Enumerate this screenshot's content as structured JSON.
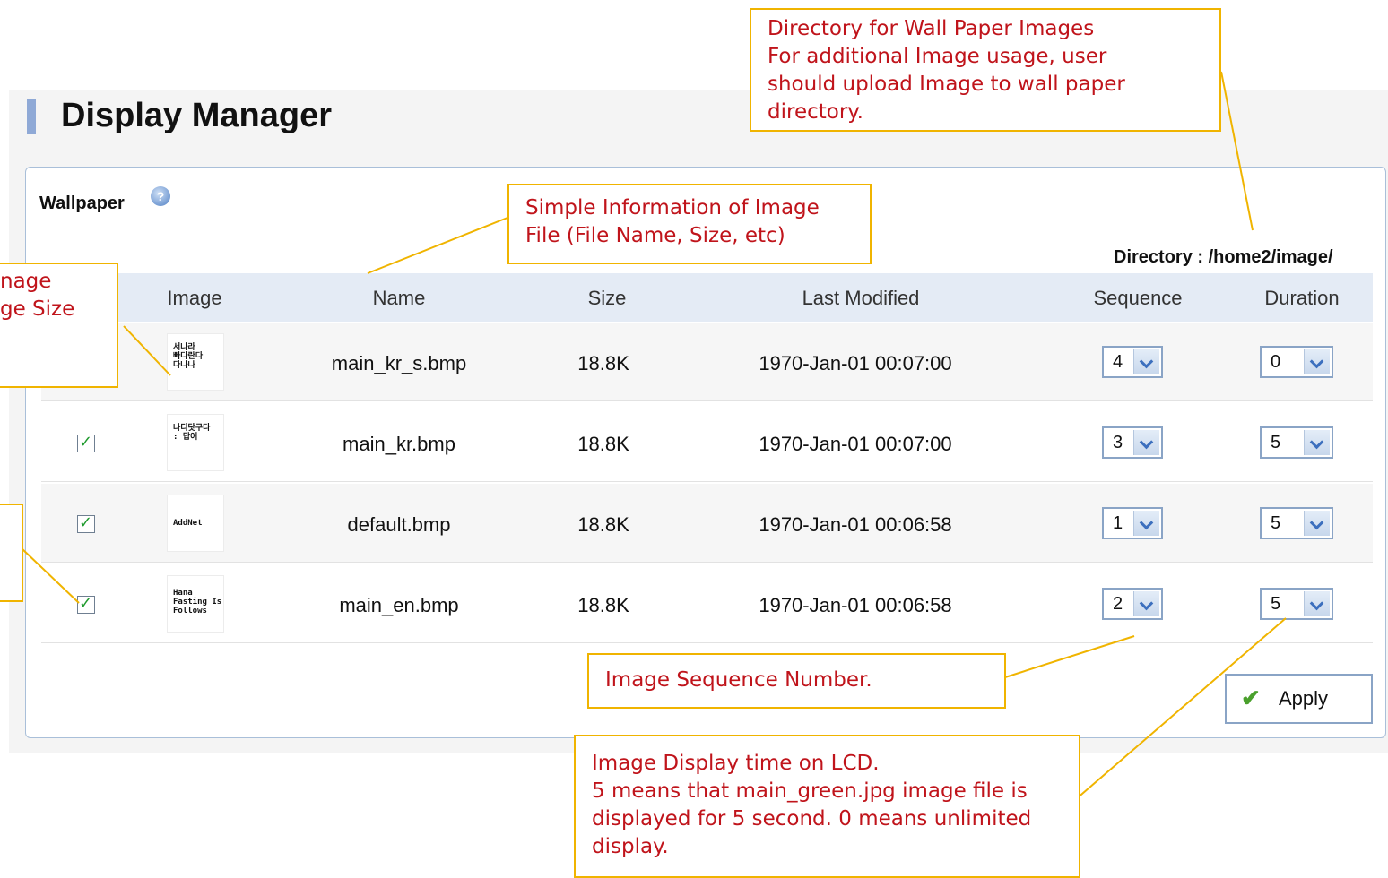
{
  "page": {
    "title": "Display Manager"
  },
  "wallpaper": {
    "label": "Wallpaper",
    "help_icon": "help-icon",
    "directory": "Directory : /home2/image/",
    "columns": [
      "Image",
      "Name",
      "Size",
      "Last Modified",
      "Sequence",
      "Duration"
    ],
    "rows": [
      {
        "checked": false,
        "thumb": "서나라\n빠다란다\n다나나",
        "name": "main_kr_s.bmp",
        "size": "18.8K",
        "modified": "1970-Jan-01 00:07:00",
        "sequence": "4",
        "duration": "0"
      },
      {
        "checked": true,
        "thumb": "나디닷구다\n: 답어",
        "name": "main_kr.bmp",
        "size": "18.8K",
        "modified": "1970-Jan-01 00:07:00",
        "sequence": "3",
        "duration": "5"
      },
      {
        "checked": true,
        "thumb": "AddNet",
        "name": "default.bmp",
        "size": "18.8K",
        "modified": "1970-Jan-01 00:06:58",
        "sequence": "1",
        "duration": "5"
      },
      {
        "checked": true,
        "thumb": "Hana\nFasting Is\nFollows",
        "name": "main_en.bmp",
        "size": "18.8K",
        "modified": "1970-Jan-01 00:06:58",
        "sequence": "2",
        "duration": "5"
      }
    ],
    "apply_label": "Apply"
  },
  "callouts": {
    "directory": [
      "Directory for Wall Paper Images",
      "For additional Image usage,  user",
      "should upload Image to wall paper",
      "directory."
    ],
    "info": [
      "Simple Information of Image",
      "File (File Name, Size, etc)"
    ],
    "image": [
      "nage",
      "",
      "ge Size"
    ],
    "sequence": [
      "Image Sequence Number."
    ],
    "duration": [
      "Image Display time on LCD.",
      "5 means that main_green.jpg image file is",
      "displayed for 5 second. 0 means unlimited",
      "display."
    ]
  },
  "colors": {
    "callout_border": "#f0b400",
    "callout_text": "#c0141b",
    "header_bg": "#e4ebf5",
    "accent": "#8fa9d6"
  }
}
